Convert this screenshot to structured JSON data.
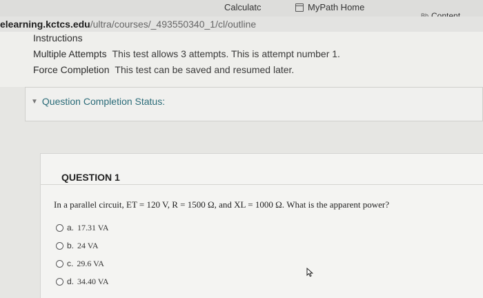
{
  "bookmarks": {
    "calculator": "Calculatc",
    "mypath": "MyPath Home",
    "content_badge": "Bb",
    "content": "Content"
  },
  "url": {
    "host": "elearning.kctcs.edu",
    "path": "/ultra/courses/_493550340_1/cl/outline"
  },
  "instructions": {
    "heading": "Instructions",
    "multiple_attempts_label": "Multiple Attempts",
    "multiple_attempts_value": "This test allows 3 attempts. This is attempt number 1.",
    "force_completion_label": "Force Completion",
    "force_completion_value": "This test can be saved and resumed later."
  },
  "status": {
    "label": "Question Completion Status:"
  },
  "question": {
    "title": "QUESTION 1",
    "text": "In a parallel circuit, ET = 120 V, R = 1500 Ω, and XL = 1000 Ω. What is the apparent power?",
    "options": [
      {
        "letter": "a.",
        "value": "17.31 VA"
      },
      {
        "letter": "b.",
        "value": "24 VA"
      },
      {
        "letter": "c.",
        "value": "29.6 VA"
      },
      {
        "letter": "d.",
        "value": "34.40 VA"
      }
    ]
  }
}
